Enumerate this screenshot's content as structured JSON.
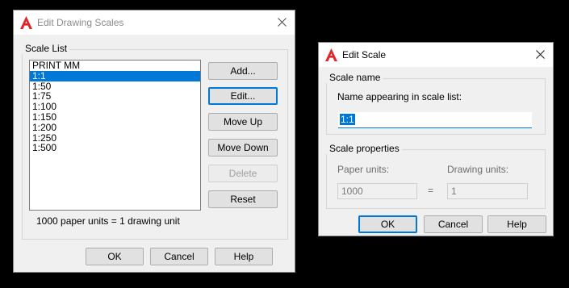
{
  "colors": {
    "accent": "#0078d7",
    "logo_red": "#e4232a",
    "background": "#000000"
  },
  "edit_drawing_scales": {
    "title": "Edit Drawing Scales",
    "scale_list_label": "Scale List",
    "scales": [
      "PRINT MM",
      "1:1",
      "1:50",
      "1:75",
      "1:100",
      "1:150",
      "1:200",
      "1:250",
      "1:500"
    ],
    "selected_scale": "1:1",
    "buttons": {
      "add": "Add...",
      "edit": "Edit...",
      "move_up": "Move Up",
      "move_down": "Move Down",
      "delete": "Delete",
      "reset": "Reset"
    },
    "status": "1000 paper units = 1 drawing unit",
    "footer": {
      "ok": "OK",
      "cancel": "Cancel",
      "help": "Help"
    }
  },
  "edit_scale": {
    "title": "Edit Scale",
    "scale_name_group": "Scale name",
    "name_label": "Name appearing in scale list:",
    "name_value": "1:1",
    "scale_props_group": "Scale properties",
    "paper_units_label": "Paper units:",
    "paper_units_value": "1000",
    "equals": "=",
    "drawing_units_label": "Drawing units:",
    "drawing_units_value": "1",
    "footer": {
      "ok": "OK",
      "cancel": "Cancel",
      "help": "Help"
    }
  }
}
